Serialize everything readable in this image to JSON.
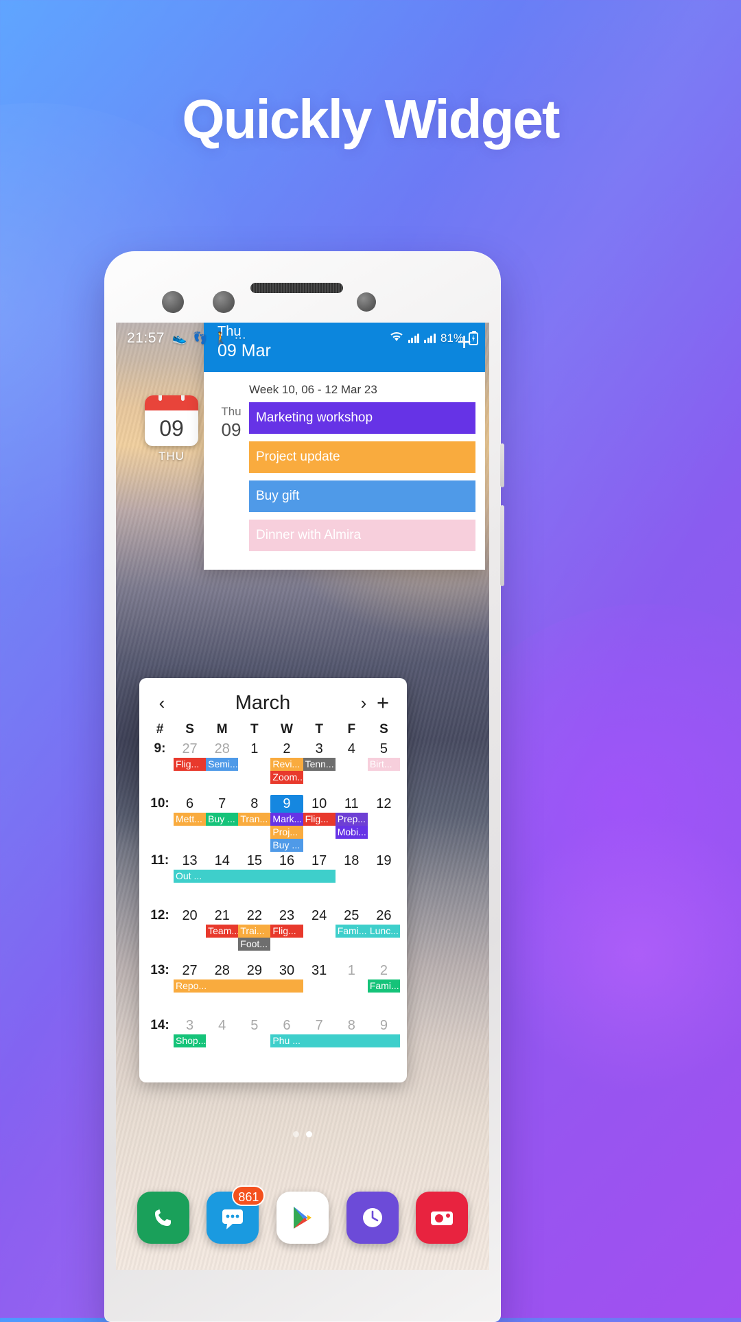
{
  "headline": "Quickly Widget",
  "status_bar": {
    "time": "21:57",
    "left_icons": [
      "shoe-icon",
      "footsteps-icon",
      "walking-icon",
      "more-icon"
    ],
    "battery_percent": "81%",
    "icons": [
      "wifi-icon",
      "signal-icon",
      "signal-icon",
      "battery-charging-icon"
    ]
  },
  "home_icon": {
    "day_number": "09",
    "weekday": "THU"
  },
  "agenda": {
    "header": {
      "weekday": "Thu",
      "date": "09 Mar",
      "add_label": "+"
    },
    "week_label": "Week 10, 06 - 12 Mar 23",
    "day": {
      "weekday": "Thu",
      "number": "09"
    },
    "events": [
      {
        "title": "Marketing workshop",
        "color": "#6633e6"
      },
      {
        "title": "Project update",
        "color": "#f9ab3e"
      },
      {
        "title": "Buy gift",
        "color": "#4f9ae8"
      },
      {
        "title": "Dinner with Almira",
        "color": "#f7cfdc"
      }
    ]
  },
  "month_widget": {
    "prev_label": "‹",
    "next_label": "›",
    "add_label": "+",
    "title": "March",
    "weekday_headers": [
      "#",
      "S",
      "M",
      "T",
      "W",
      "T",
      "F",
      "S"
    ],
    "weeks": [
      {
        "number": "9:",
        "days": [
          {
            "n": "27",
            "dim": true
          },
          {
            "n": "28",
            "dim": true
          },
          {
            "n": "1"
          },
          {
            "n": "2"
          },
          {
            "n": "3"
          },
          {
            "n": "4"
          },
          {
            "n": "5"
          }
        ],
        "chips": [
          {
            "label": "Flig...",
            "color": "#e8392c",
            "start": 0,
            "span": 1,
            "row": 0
          },
          {
            "label": "Semi...",
            "color": "#4f9ae8",
            "start": 1,
            "span": 1,
            "row": 0
          },
          {
            "label": "Revi...",
            "color": "#f9ab3e",
            "start": 3,
            "span": 1,
            "row": 0
          },
          {
            "label": "Tenn...",
            "color": "#6e6e6e",
            "start": 4,
            "span": 1,
            "row": 0
          },
          {
            "label": "Birt...",
            "color": "#f7cfdc",
            "start": 6,
            "span": 1,
            "row": 0
          },
          {
            "label": "Zoom...",
            "color": "#e8392c",
            "start": 3,
            "span": 1,
            "row": 1
          }
        ]
      },
      {
        "number": "10:",
        "days": [
          {
            "n": "6"
          },
          {
            "n": "7"
          },
          {
            "n": "8"
          },
          {
            "n": "9",
            "sel": true
          },
          {
            "n": "10"
          },
          {
            "n": "11"
          },
          {
            "n": "12"
          }
        ],
        "chips": [
          {
            "label": "Mett...",
            "color": "#f9ab3e",
            "start": 0,
            "span": 1,
            "row": 0
          },
          {
            "label": "Buy ...",
            "color": "#15c379",
            "start": 1,
            "span": 1,
            "row": 0
          },
          {
            "label": "Tran...",
            "color": "#f9ab3e",
            "start": 2,
            "span": 1,
            "row": 0
          },
          {
            "label": "Mark...",
            "color": "#6633e6",
            "start": 3,
            "span": 1,
            "row": 0
          },
          {
            "label": "Flig...",
            "color": "#e8392c",
            "start": 4,
            "span": 1,
            "row": 0
          },
          {
            "label": "Prep...",
            "color": "#6e3fd4",
            "start": 5,
            "span": 1,
            "row": 0
          },
          {
            "label": "Proj...",
            "color": "#f9ab3e",
            "start": 3,
            "span": 1,
            "row": 1
          },
          {
            "label": "Mobi...",
            "color": "#6633e6",
            "start": 5,
            "span": 1,
            "row": 1
          },
          {
            "label": "Buy ...",
            "color": "#4f9ae8",
            "start": 3,
            "span": 1,
            "row": 2
          }
        ]
      },
      {
        "number": "11:",
        "days": [
          {
            "n": "13"
          },
          {
            "n": "14"
          },
          {
            "n": "15"
          },
          {
            "n": "16"
          },
          {
            "n": "17"
          },
          {
            "n": "18"
          },
          {
            "n": "19"
          }
        ],
        "chips": [
          {
            "label": "Out ...",
            "color": "#3ecfcb",
            "start": 0,
            "span": 5,
            "row": 0
          }
        ]
      },
      {
        "number": "12:",
        "days": [
          {
            "n": "20"
          },
          {
            "n": "21"
          },
          {
            "n": "22"
          },
          {
            "n": "23"
          },
          {
            "n": "24"
          },
          {
            "n": "25"
          },
          {
            "n": "26"
          }
        ],
        "chips": [
          {
            "label": "Team...",
            "color": "#e8392c",
            "start": 1,
            "span": 1,
            "row": 0
          },
          {
            "label": "Trai...",
            "color": "#f9ab3e",
            "start": 2,
            "span": 1,
            "row": 0
          },
          {
            "label": "Flig...",
            "color": "#e8392c",
            "start": 3,
            "span": 1,
            "row": 0
          },
          {
            "label": "Fami...",
            "color": "#3ecfcb",
            "start": 5,
            "span": 1,
            "row": 0
          },
          {
            "label": "Lunc...",
            "color": "#3ecfcb",
            "start": 6,
            "span": 1,
            "row": 0
          },
          {
            "label": "Foot...",
            "color": "#6e6e6e",
            "start": 2,
            "span": 1,
            "row": 1
          }
        ]
      },
      {
        "number": "13:",
        "days": [
          {
            "n": "27"
          },
          {
            "n": "28"
          },
          {
            "n": "29"
          },
          {
            "n": "30"
          },
          {
            "n": "31"
          },
          {
            "n": "1",
            "dim": true
          },
          {
            "n": "2",
            "dim": true
          }
        ],
        "chips": [
          {
            "label": "Repo...",
            "color": "#f9ab3e",
            "start": 0,
            "span": 4,
            "row": 0
          },
          {
            "label": "Fami...",
            "color": "#15c379",
            "start": 6,
            "span": 1,
            "row": 0
          }
        ]
      },
      {
        "number": "14:",
        "days": [
          {
            "n": "3",
            "dim": true
          },
          {
            "n": "4",
            "dim": true
          },
          {
            "n": "5",
            "dim": true
          },
          {
            "n": "6",
            "dim": true
          },
          {
            "n": "7",
            "dim": true
          },
          {
            "n": "8",
            "dim": true
          },
          {
            "n": "9",
            "dim": true
          }
        ],
        "chips": [
          {
            "label": "Shop...",
            "color": "#15c379",
            "start": 0,
            "span": 1,
            "row": 0
          },
          {
            "label": "Phu ...",
            "color": "#3ecfcb",
            "start": 3,
            "span": 4,
            "row": 0
          }
        ]
      }
    ]
  },
  "dock": {
    "apps": [
      {
        "name": "phone-app",
        "color": "#1aa05a"
      },
      {
        "name": "messages-app",
        "color": "#1a9ae0",
        "badge": "861"
      },
      {
        "name": "play-store-app",
        "color": "#ffffff"
      },
      {
        "name": "clock-app",
        "color": "#6c4bd8"
      },
      {
        "name": "camera-app",
        "color": "#e8233f"
      }
    ]
  },
  "page_dots": {
    "count": 2,
    "active_index": 1
  }
}
